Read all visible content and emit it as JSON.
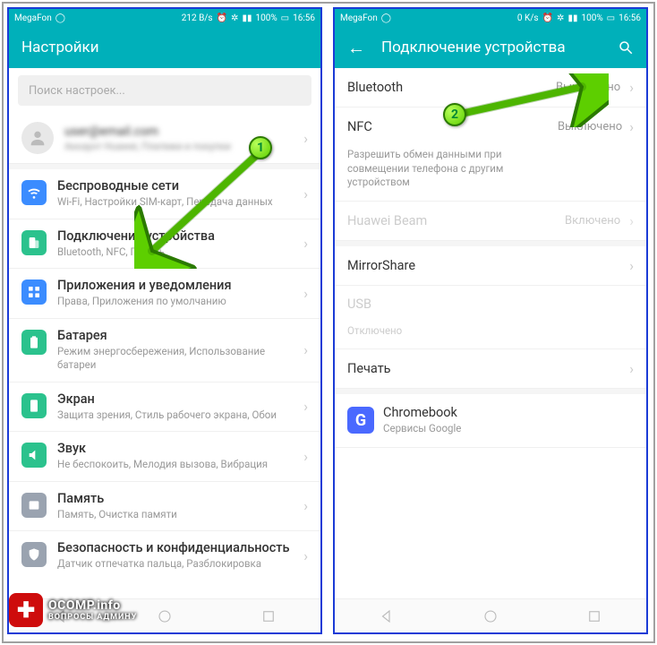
{
  "status": {
    "carrier": "MegaFon",
    "speed_left": "212 B/s",
    "speed_right": "0 K/s",
    "battery": "100%",
    "time": "16:56"
  },
  "left": {
    "title": "Настройки",
    "search_placeholder": "Поиск настроек...",
    "account": {
      "line1": "user@email.com",
      "line2": "Аккаунт Huawei, Платежи и покупки"
    },
    "rows": [
      {
        "icon": "wifi",
        "color": "#3b8cff",
        "title": "Беспроводные сети",
        "sub": "Wi-Fi, Настройки SIM-карт, Передача данных"
      },
      {
        "icon": "device",
        "color": "#2bc28d",
        "title": "Подключение устройства",
        "sub": "Bluetooth, NFC, Печать"
      },
      {
        "icon": "apps",
        "color": "#3b8cff",
        "title": "Приложения и уведомления",
        "sub": "Права, Приложения по умолчанию"
      },
      {
        "icon": "battery",
        "color": "#2bc28d",
        "title": "Батарея",
        "sub": "Режим энергосбережения, Использование батареи"
      },
      {
        "icon": "screen",
        "color": "#2bc28d",
        "title": "Экран",
        "sub": "Защита зрения, Стиль рабочего экрана, Обои"
      },
      {
        "icon": "sound",
        "color": "#2bc28d",
        "title": "Звук",
        "sub": "Не беспокоить, Мелодия вызова, Вибрация"
      },
      {
        "icon": "storage",
        "color": "#9aa3b0",
        "title": "Память",
        "sub": "Память, Очистка памяти"
      },
      {
        "icon": "security",
        "color": "#9aa3b0",
        "title": "Безопасность и конфиденциальность",
        "sub": "Датчик отпечатка пальца, Разблокировка"
      }
    ]
  },
  "right": {
    "title": "Подключение устройства",
    "rows": {
      "bluetooth": {
        "title": "Bluetooth",
        "value": "Выключено"
      },
      "nfc": {
        "title": "NFC",
        "sub": "Разрешить обмен данными при совмещении телефона с другим устройством",
        "value": "Выключено"
      },
      "beam": {
        "title": "Huawei Beam",
        "value": "Включено"
      },
      "mirror": {
        "title": "MirrorShare"
      },
      "usb": {
        "title": "USB",
        "sub": "Отключено"
      },
      "print": {
        "title": "Печать"
      },
      "chromebook": {
        "title": "Chromebook",
        "sub": "Сервисы Google"
      }
    }
  },
  "annotations": {
    "step1": "1",
    "step2": "2"
  },
  "watermark": {
    "site": "OCOMP.info",
    "sub": "ВОПРОСЫ АДМИНУ"
  }
}
